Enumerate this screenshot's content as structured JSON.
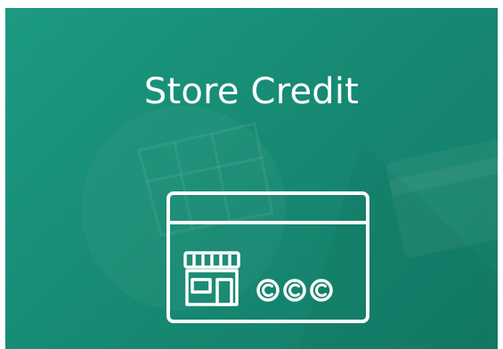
{
  "banner": {
    "title": "Store Credit",
    "icon": "store-credit-card-icon",
    "colors": {
      "background": "#178b74",
      "foreground": "#ffffff"
    }
  }
}
